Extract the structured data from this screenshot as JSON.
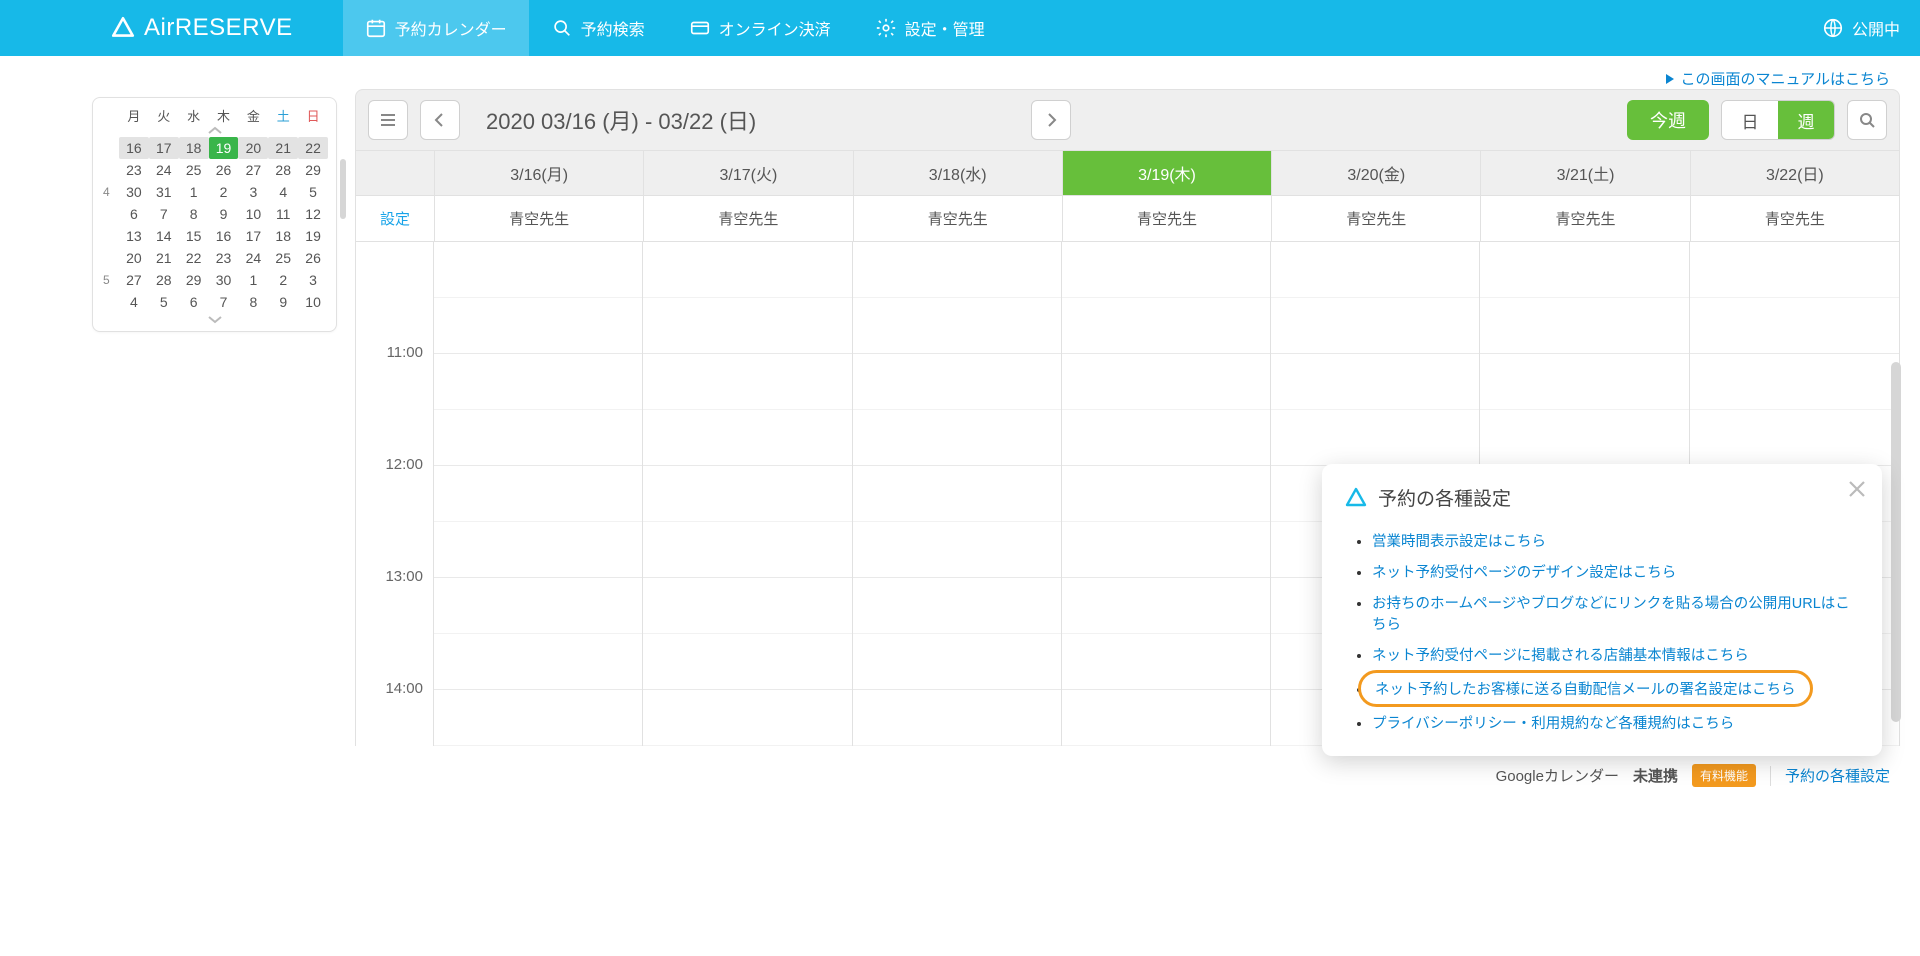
{
  "brand": "AirRESERVE",
  "nav": {
    "items": [
      {
        "label": "予約カレンダー",
        "icon": "calendar"
      },
      {
        "label": "予約検索",
        "icon": "search"
      },
      {
        "label": "オンライン決済",
        "icon": "card"
      },
      {
        "label": "設定・管理",
        "icon": "gear"
      }
    ],
    "publish": "公開中"
  },
  "manual_link": "この画面のマニュアルはこちら",
  "minical": {
    "dow": [
      "月",
      "火",
      "水",
      "木",
      "金",
      "土",
      "日"
    ],
    "months": {
      "apr": "4",
      "may": "5"
    },
    "rows": [
      {
        "m": "",
        "hl": true,
        "days": [
          "16",
          "17",
          "18",
          "19",
          "20",
          "21",
          "22"
        ],
        "today_idx": 3
      },
      {
        "m": "",
        "days": [
          "23",
          "24",
          "25",
          "26",
          "27",
          "28",
          "29"
        ]
      },
      {
        "m": "4",
        "days": [
          "30",
          "31",
          "1",
          "2",
          "3",
          "4",
          "5"
        ]
      },
      {
        "m": "",
        "days": [
          "6",
          "7",
          "8",
          "9",
          "10",
          "11",
          "12"
        ]
      },
      {
        "m": "",
        "days": [
          "13",
          "14",
          "15",
          "16",
          "17",
          "18",
          "19"
        ]
      },
      {
        "m": "",
        "days": [
          "20",
          "21",
          "22",
          "23",
          "24",
          "25",
          "26"
        ]
      },
      {
        "m": "5",
        "days": [
          "27",
          "28",
          "29",
          "30",
          "1",
          "2",
          "3"
        ]
      },
      {
        "m": "",
        "days": [
          "4",
          "5",
          "6",
          "7",
          "8",
          "9",
          "10"
        ]
      }
    ]
  },
  "toolbar": {
    "date_range": "2020 03/16 (月) - 03/22 (日)",
    "today_btn": "今週",
    "seg_day": "日",
    "seg_week": "週"
  },
  "cal": {
    "settings": "設定",
    "days": [
      "3/16(月)",
      "3/17(火)",
      "3/18(水)",
      "3/19(木)",
      "3/20(金)",
      "3/21(土)",
      "3/22(日)"
    ],
    "today_idx": 3,
    "resource": "青空先生",
    "times": [
      "11:00",
      "12:00",
      "13:00",
      "14:00"
    ]
  },
  "popup": {
    "title": "予約の各種設定",
    "links": [
      "営業時間表示設定はこちら",
      "ネット予約受付ページのデザイン設定はこちら",
      "お持ちのホームページやブログなどにリンクを貼る場合の公開用URLはこちら",
      "ネット予約受付ページに掲載される店舗基本情報はこちら",
      "ネット予約したお客様に送る自動配信メールの署名設定はこちら",
      "プライバシーポリシー・利用規約など各種規約はこちら"
    ],
    "highlight_idx": 4
  },
  "footer": {
    "gcal": "Googleカレンダー",
    "status": "未連携",
    "paid": "有料機能",
    "settings_link": "予約の各種設定"
  }
}
